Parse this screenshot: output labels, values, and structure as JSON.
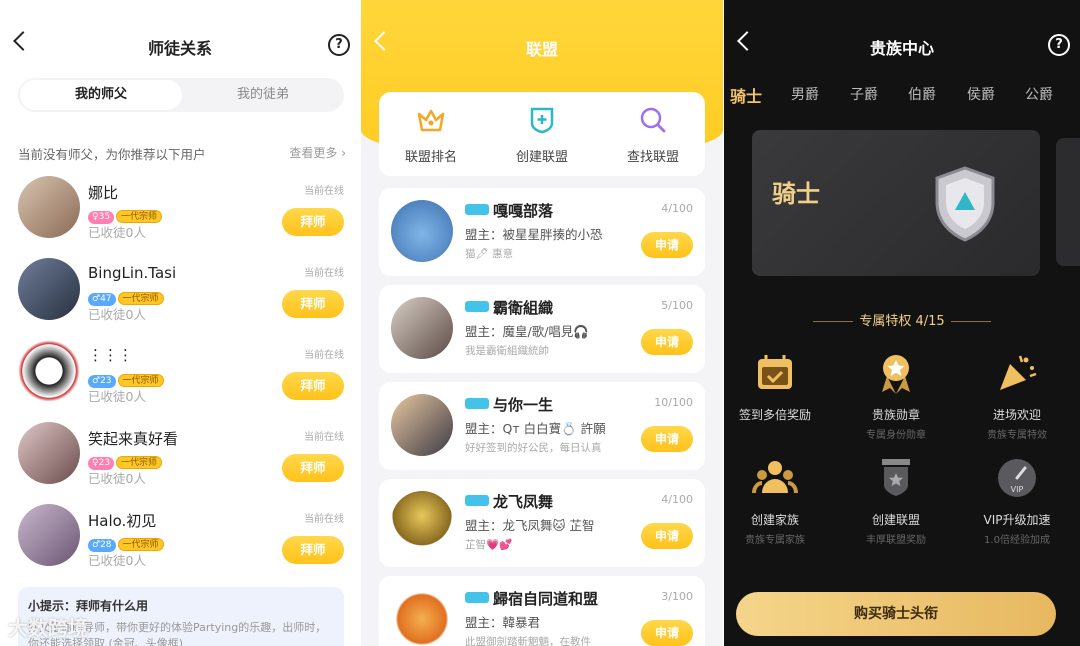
{
  "p1": {
    "title": "师徒关系",
    "tabs": [
      "我的师父",
      "我的徒弟"
    ],
    "tip": "当前没有师父，为你推荐以下用户",
    "more": "查看更多",
    "btn": "拜师",
    "list": [
      {
        "name": "娜比",
        "badge1": "♀35",
        "badge2": "一代宗师",
        "sub": "已收徒0人",
        "online": "当前在线"
      },
      {
        "name": "BingLin.Tasi",
        "badge1": "♂47",
        "badge2": "一代宗师",
        "sub": "已收徒0人",
        "online": "当前在线"
      },
      {
        "name": "⋮⋮⋮",
        "badge1": "♂23",
        "badge2": "一代宗师",
        "sub": "已收徒0人",
        "online": "当前在线"
      },
      {
        "name": "笑起来真好看",
        "badge1": "♀23",
        "badge2": "一代宗师",
        "sub": "已收徒0人",
        "online": "当前在线"
      },
      {
        "name": "Halo.初见",
        "badge1": "♂28",
        "badge2": "一代宗师",
        "sub": "已收徒0人",
        "online": "当前在线"
      }
    ],
    "hint": {
      "title": "小提示：拜师有什么用",
      "desc": "师父是你的导师，带你更好的体验Partying的乐趣，出师时，你还能选择领取 (金冠、头像框)"
    }
  },
  "p2": {
    "title": "联盟",
    "actions": [
      "联盟排名",
      "创建联盟",
      "查找联盟"
    ],
    "btn": "申请",
    "list": [
      {
        "name": "嘎嘎部落",
        "leader": "盟主：被星星胖揍的小恐",
        "desc": "猫🖊 惠意",
        "count": "4/100"
      },
      {
        "name": "霸衛組織",
        "leader": "盟主：魔皇/歌/唱見🎧",
        "desc": "我是霸衛組織統帥",
        "count": "5/100"
      },
      {
        "name": "与你一生",
        "leader": "盟主：Qт 白白寶💍 許願",
        "desc": "好好签到的好公民，每日认真",
        "count": "10/100"
      },
      {
        "name": "龙飞凤舞",
        "leader": "盟主：龙飞凤舞🐱 芷智",
        "desc": "芷智💗💕",
        "count": "4/100"
      },
      {
        "name": "歸宿自同道和盟",
        "leader": "盟主：韓暴君",
        "desc": "此盟御劍踏斬魍魎，在教件",
        "count": "3/100"
      }
    ]
  },
  "p3": {
    "title": "贵族中心",
    "ranks": [
      "骑士",
      "男爵",
      "子爵",
      "伯爵",
      "侯爵",
      "公爵"
    ],
    "hero": "骑士",
    "priv": "专属特权 4/15",
    "feats": [
      {
        "a": "签到多倍奖励",
        "b": ""
      },
      {
        "a": "贵族勋章",
        "b": "专属身份勋章"
      },
      {
        "a": "进场欢迎",
        "b": "贵族专属特效"
      },
      {
        "a": "创建家族",
        "b": "贵族专属家族"
      },
      {
        "a": "创建联盟",
        "b": "丰厚联盟奖励"
      },
      {
        "a": "VIP升级加速",
        "b": "1.0倍经验加成"
      }
    ],
    "buy": "购买骑士头衔"
  },
  "watermark": "大数跨境"
}
